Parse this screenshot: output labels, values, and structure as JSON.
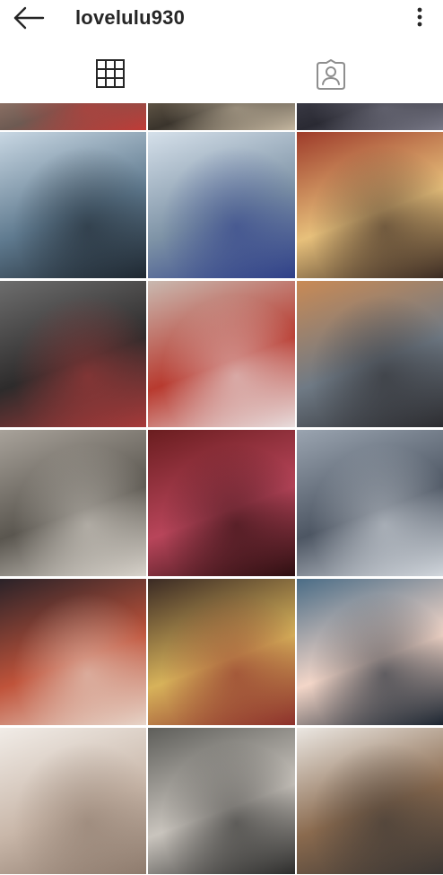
{
  "header": {
    "username": "lovelulu930",
    "back_icon": "arrow-left-icon",
    "more_icon": "more-vertical-icon"
  },
  "tabs": [
    {
      "name": "grid",
      "icon": "grid-icon",
      "active": true
    },
    {
      "name": "tagged",
      "icon": "tagged-user-icon",
      "active": false
    }
  ],
  "photos": [
    {
      "id": "p0",
      "colors": [
        "#b08a7a",
        "#6d5a52",
        "#c23a36"
      ]
    },
    {
      "id": "p1",
      "colors": [
        "#8a7a63",
        "#3a342c",
        "#c7b9a2"
      ]
    },
    {
      "id": "p2",
      "colors": [
        "#4a4a57",
        "#2a2a33",
        "#7a7a88"
      ]
    },
    {
      "id": "p3",
      "colors": [
        "#c8d7e3",
        "#5f7a8f",
        "#1e2730"
      ]
    },
    {
      "id": "p4",
      "colors": [
        "#d5e0ea",
        "#7e93a6",
        "#2e3f88"
      ]
    },
    {
      "id": "p5",
      "colors": [
        "#9e3b2a",
        "#e7c07b",
        "#3a2a22"
      ]
    },
    {
      "id": "p6",
      "colors": [
        "#6d6d6d",
        "#2d2b2b",
        "#a83a3a"
      ]
    },
    {
      "id": "p7",
      "colors": [
        "#c9b9b0",
        "#b83a2f",
        "#e8dede"
      ]
    },
    {
      "id": "p8",
      "colors": [
        "#c98a55",
        "#6f7a85",
        "#2c2c30"
      ]
    },
    {
      "id": "p9",
      "colors": [
        "#a8a29a",
        "#5a564f",
        "#d9d4cc"
      ]
    },
    {
      "id": "p10",
      "colors": [
        "#6a1d1f",
        "#b8455a",
        "#2c0e10"
      ]
    },
    {
      "id": "p11",
      "colors": [
        "#9aa4b0",
        "#4d5663",
        "#d2d7dd"
      ]
    },
    {
      "id": "p12",
      "colors": [
        "#2a2228",
        "#c0533a",
        "#e7d5c9"
      ]
    },
    {
      "id": "p13",
      "colors": [
        "#3a2a24",
        "#d7b25a",
        "#8c2f2b"
      ]
    },
    {
      "id": "p14",
      "colors": [
        "#4a6c86",
        "#f3d6c8",
        "#1a2430"
      ]
    },
    {
      "id": "p15",
      "colors": [
        "#f1ece7",
        "#c9b7a9",
        "#8d7a6c"
      ]
    },
    {
      "id": "p16",
      "colors": [
        "#5e5e5a",
        "#c9c4bd",
        "#2b2b2a"
      ]
    },
    {
      "id": "p17",
      "colors": [
        "#ebe7e2",
        "#8a6a4e",
        "#3b3633"
      ]
    }
  ]
}
